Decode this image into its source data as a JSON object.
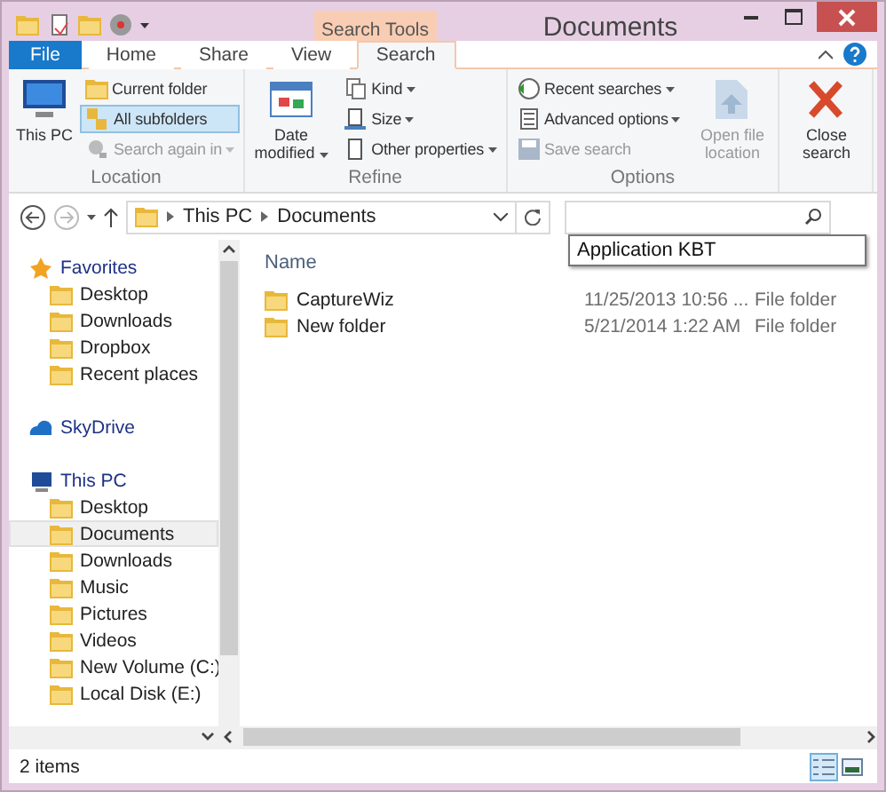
{
  "window": {
    "title": "Documents",
    "context_group": "Search Tools"
  },
  "tabs": [
    {
      "label": "File",
      "kind": "file",
      "selected": false
    },
    {
      "label": "Home",
      "kind": "tab",
      "selected": false
    },
    {
      "label": "Share",
      "kind": "tab",
      "selected": false
    },
    {
      "label": "View",
      "kind": "tab",
      "selected": false
    },
    {
      "label": "Search",
      "kind": "context",
      "selected": true
    }
  ],
  "ribbon": [
    {
      "label": "Location",
      "buttons": [
        {
          "kind": "large",
          "label": "This PC",
          "dropdown": false,
          "disabled": false,
          "selected": false
        },
        {
          "kind": "small",
          "label": "Current folder",
          "dropdown": false,
          "disabled": false,
          "selected": false
        },
        {
          "kind": "small",
          "label": "All subfolders",
          "dropdown": false,
          "disabled": false,
          "selected": true
        },
        {
          "kind": "small",
          "label": "Search again in",
          "dropdown": true,
          "disabled": true,
          "selected": false
        }
      ]
    },
    {
      "label": "Refine",
      "buttons": [
        {
          "kind": "large",
          "label": "Date modified",
          "dropdown": true,
          "disabled": false
        },
        {
          "kind": "small",
          "label": "Kind",
          "dropdown": true,
          "disabled": false
        },
        {
          "kind": "small",
          "label": "Size",
          "dropdown": true,
          "disabled": false
        },
        {
          "kind": "small",
          "label": "Other properties",
          "dropdown": true,
          "disabled": false
        }
      ]
    },
    {
      "label": "Options",
      "buttons": [
        {
          "kind": "small",
          "label": "Recent searches",
          "dropdown": true,
          "disabled": false
        },
        {
          "kind": "small",
          "label": "Advanced options",
          "dropdown": true,
          "disabled": false
        },
        {
          "kind": "small",
          "label": "Save search",
          "dropdown": false,
          "disabled": true
        },
        {
          "kind": "large",
          "label": "Open file location",
          "dropdown": false,
          "disabled": true
        }
      ]
    },
    {
      "buttons": [
        {
          "kind": "large",
          "label": "Close search",
          "dropdown": false,
          "disabled": false
        }
      ]
    }
  ],
  "address": {
    "path": [
      "This PC",
      "Documents"
    ]
  },
  "tooltip": "Application KBT",
  "nav": [
    {
      "label": "Favorites",
      "selected": false,
      "children": [
        {
          "label": "Desktop",
          "selected": false
        },
        {
          "label": "Downloads",
          "selected": false
        },
        {
          "label": "Dropbox",
          "selected": false
        },
        {
          "label": "Recent places",
          "selected": false
        }
      ]
    },
    {
      "label": "SkyDrive",
      "selected": false
    },
    {
      "label": "This PC",
      "selected": false,
      "children": [
        {
          "label": "Desktop",
          "selected": false
        },
        {
          "label": "Documents",
          "selected": true
        },
        {
          "label": "Downloads",
          "selected": false
        },
        {
          "label": "Music",
          "selected": false
        },
        {
          "label": "Pictures",
          "selected": false
        },
        {
          "label": "Videos",
          "selected": false
        },
        {
          "label": "New Volume (C:)",
          "selected": false
        },
        {
          "label": "Local Disk (E:)",
          "selected": false
        }
      ]
    }
  ],
  "columns": [
    {
      "label": "Name"
    }
  ],
  "files": [
    {
      "name": "CaptureWiz",
      "date": "11/25/2013 10:56 ...",
      "type": "File folder"
    },
    {
      "name": "New folder",
      "date": "5/21/2014 1:22 AM",
      "type": "File folder"
    }
  ],
  "status_bar": {
    "count": "2 items",
    "views": [
      {
        "selected": true
      },
      {
        "selected": false
      }
    ]
  }
}
